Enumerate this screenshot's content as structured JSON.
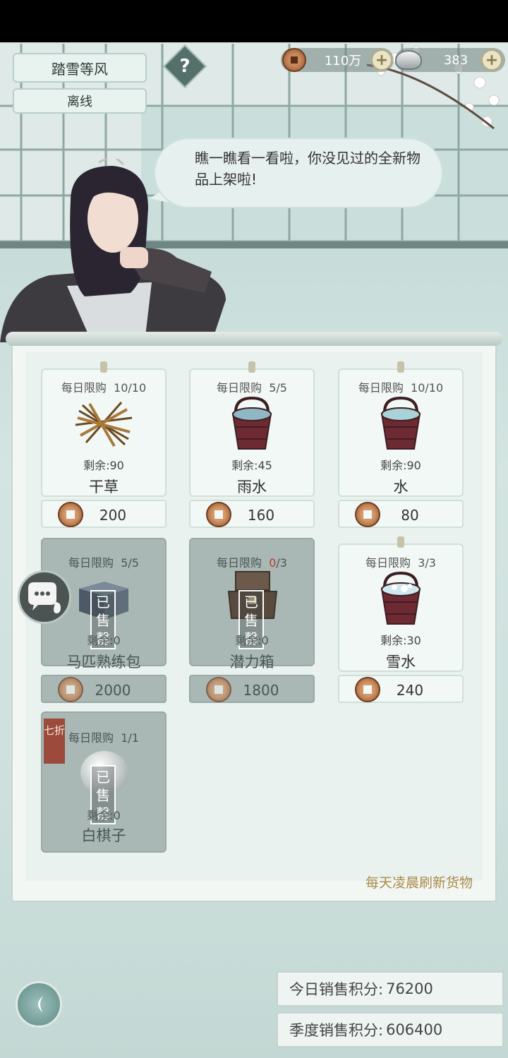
{
  "header": {
    "player_name": "踏雪等风",
    "status": "离线",
    "help_icon": "?",
    "coins_value": "110万",
    "ingots_value": "383",
    "plus": "+"
  },
  "dialogue": {
    "line": "瞧一瞧看一看啦，你没见过的全新物品上架啦!"
  },
  "shop": {
    "items": [
      {
        "limit_label": "每日限购",
        "limit": "10/10",
        "remain": "剩余:90",
        "name": "干草",
        "price": "200",
        "sold_out": false,
        "icon": "hay-icon"
      },
      {
        "limit_label": "每日限购",
        "limit": "5/5",
        "remain": "剩余:45",
        "name": "雨水",
        "price": "160",
        "sold_out": false,
        "icon": "rain-bucket-icon"
      },
      {
        "limit_label": "每日限购",
        "limit": "10/10",
        "remain": "剩余:90",
        "name": "水",
        "price": "80",
        "sold_out": false,
        "icon": "water-bucket-icon"
      },
      {
        "limit_label": "每日限购",
        "limit": "5/5",
        "remain": "剩余:0",
        "name": "马匹熟练包",
        "price": "2000",
        "sold_out": true,
        "icon": "package-icon"
      },
      {
        "limit_label": "每日限购",
        "limit_used": "0",
        "limit_total": "/3",
        "remain": "剩余:0",
        "name": "潜力箱",
        "price": "1800",
        "sold_out": true,
        "icon": "chest-icon"
      },
      {
        "limit_label": "每日限购",
        "limit": "3/3",
        "remain": "剩余:30",
        "name": "雪水",
        "price": "240",
        "sold_out": false,
        "icon": "snow-bucket-icon"
      },
      {
        "limit_label": "每日限购",
        "limit": "1/1",
        "remain": "剩余:0",
        "name": "白棋子",
        "price": "",
        "sold_out": true,
        "icon": "go-stone-icon",
        "discount": "七折"
      }
    ],
    "sold_label": [
      "已",
      "售",
      "罄"
    ],
    "refresh_note": "每天凌晨刷新货物"
  },
  "scores": {
    "today_label": "今日销售积分:",
    "today_value": "76200",
    "season_label": "季度销售积分:",
    "season_value": "606400"
  }
}
